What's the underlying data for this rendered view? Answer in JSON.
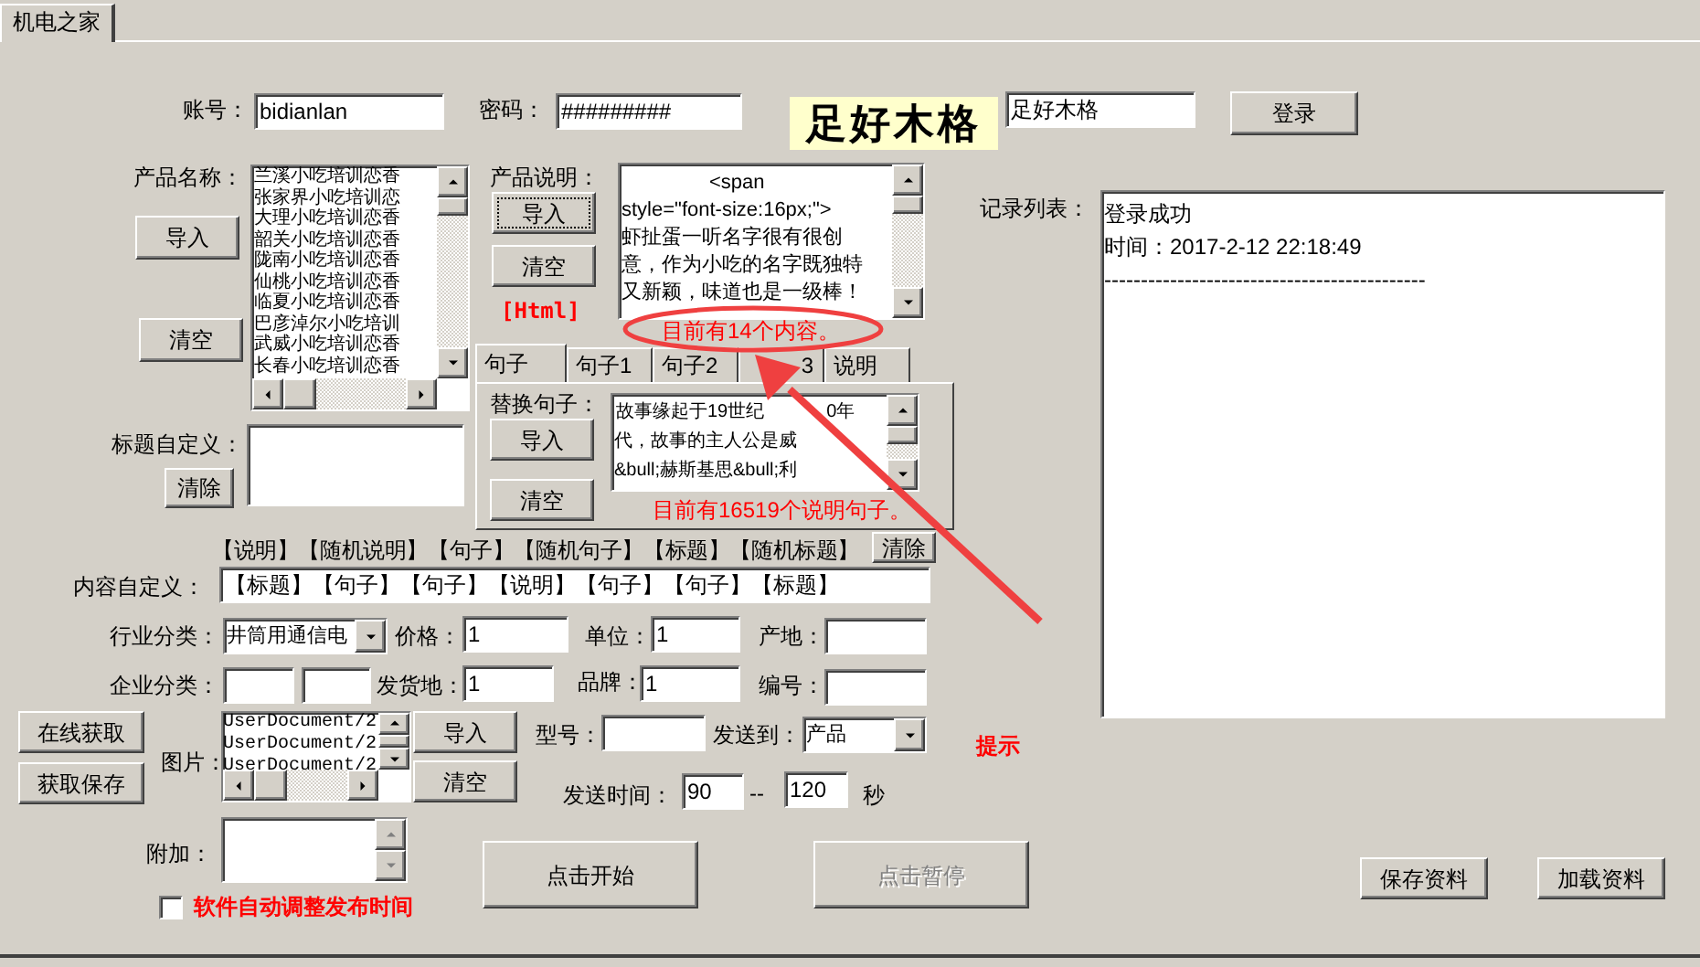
{
  "window_tab": {
    "label": "机电之家",
    "selected": true
  },
  "login": {
    "account_label": "账号：",
    "account": "bidianlan",
    "password_label": "密码：",
    "password": "#########",
    "captcha": "足好木格",
    "captcha_input": "足好木格",
    "login_button": "登录"
  },
  "product_names": {
    "label": "产品名称：",
    "import_button": "导入",
    "clear_button": "清空",
    "items": [
      "兰溪小吃培训恋香",
      "张家界小吃培训恋",
      "大理小吃培训恋香",
      "韶关小吃培训恋香",
      "陇南小吃培训恋香",
      "仙桃小吃培训恋香",
      "临夏小吃培训恋香",
      "巴彦淖尔小吃培训",
      "武威小吃培训恋香",
      "长春小吃培训恋香"
    ]
  },
  "product_description": {
    "label": "产品说明：",
    "import_button": {
      "label": "导入",
      "focused": true
    },
    "clear_button": "清空",
    "html_tag": "[Html]",
    "lines": [
      "<span",
      "style=\"font-size:16px;\">",
      "虾扯蛋一听名字很有很创",
      "意，作为小吃的名字既独特",
      "又新颖，味道也是一级棒！"
    ],
    "count_note": "目前有14个内容。"
  },
  "sentence_tabs": [
    {
      "label": "句子",
      "selected": true
    },
    {
      "label": "句子1",
      "selected": false
    },
    {
      "label": "句子2",
      "selected": false
    },
    {
      "label": "3",
      "selected": false
    },
    {
      "label": "说明",
      "selected": false
    }
  ],
  "sentence_panel": {
    "label": "替换句子：",
    "import_button": "导入",
    "clear_button": "清空",
    "lines": [
      [
        "故事缘起于19世纪",
        "0年"
      ],
      [
        "代，故事的主人公是威"
      ],
      [
        "&bull;赫斯基思&bull;利"
      ]
    ],
    "count_note": "目前有16519个说明句子。"
  },
  "title_custom": {
    "label": "标题自定义：",
    "clear_button": "清除"
  },
  "content_tags": "【说明】【随机说明】【句子】【随机句子】【标题】【随机标题】",
  "content_clear_button": "清除",
  "content_custom": {
    "label": "内容自定义：",
    "value": "【标题】【句子】【句子】【说明】【句子】【句子】【标题】"
  },
  "industry": {
    "label": "行业分类：",
    "value": "井筒用通信电"
  },
  "price": {
    "label": "价格：",
    "value": "1"
  },
  "unit": {
    "label": "单位：",
    "value": "1"
  },
  "origin": {
    "label": "产地："
  },
  "company": {
    "label": "企业分类："
  },
  "ship_from": {
    "label": "发货地：",
    "value": "1"
  },
  "brand": {
    "label": "品牌：",
    "value": "1"
  },
  "serial": {
    "label": "编号："
  },
  "online_fetch_button": "在线获取",
  "fetch_save_button": "获取保存",
  "images": {
    "label": "图片：",
    "items": [
      "UserDocument/2",
      "UserDocument/2",
      "UserDocument/2"
    ],
    "import_button": "导入",
    "clear_button": "清空"
  },
  "model": {
    "label": "型号："
  },
  "send_to": {
    "label": "发送到：",
    "value": "产品"
  },
  "hint": "提示",
  "send_time": {
    "label": "发送时间：",
    "from": "90",
    "separator": "--",
    "to": "120",
    "unit": "秒"
  },
  "extra": {
    "label": "附加："
  },
  "auto_adjust": {
    "label": "软件自动调整发布时间",
    "checked": false
  },
  "start_button": {
    "label": "点击开始",
    "disabled": false
  },
  "pause_button": {
    "label": "点击暂停",
    "disabled": true
  },
  "log": {
    "label": "记录列表：",
    "lines": [
      "登录成功",
      "时间：2017-2-12 22:18:49",
      "--------------------------------------------"
    ]
  },
  "save_button": "保存资料",
  "load_button": "加载资料"
}
